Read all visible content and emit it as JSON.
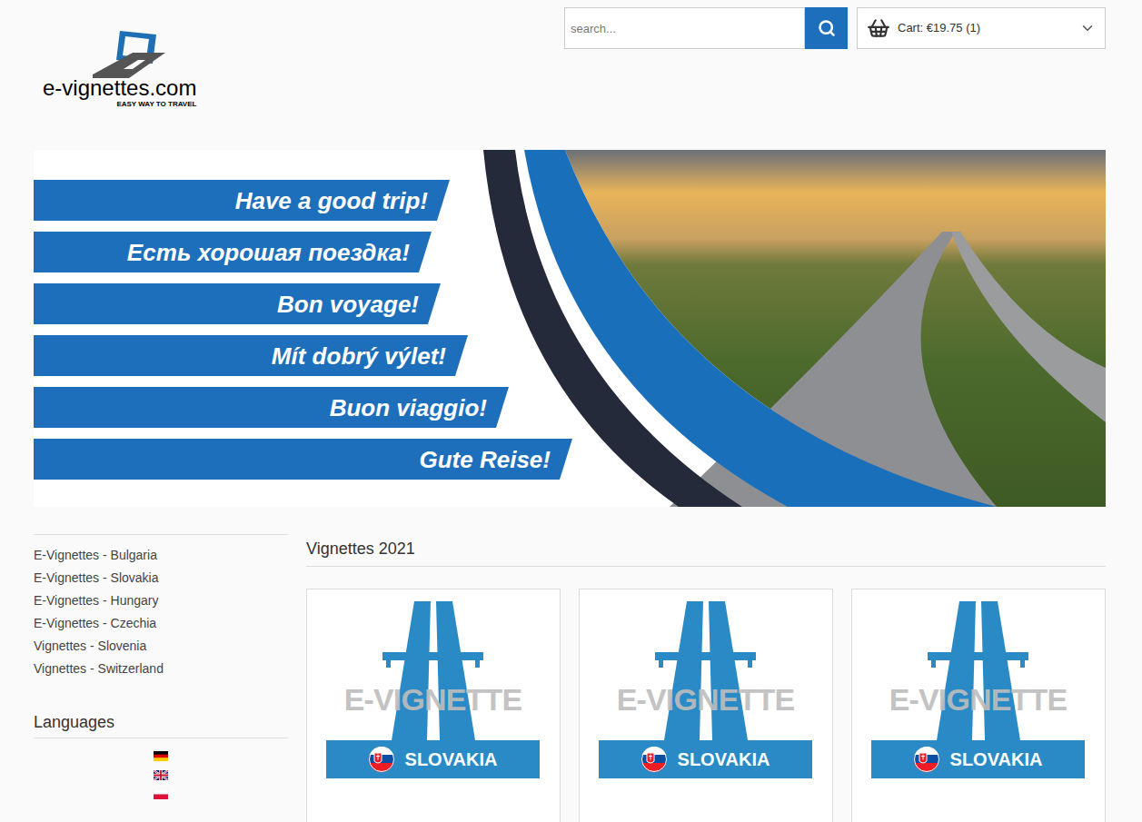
{
  "logo": {
    "name": "e-vignettes.com",
    "tagline": "EASY WAY TO TRAVEL"
  },
  "search": {
    "placeholder": "search..."
  },
  "cart": {
    "label": "Cart: €19.75 (1)"
  },
  "banner": {
    "lines": [
      "Have a good trip!",
      "Есть хорошая поездка!",
      "Bon voyage!",
      "Mít dobrý výlet!",
      "Buon viaggio!",
      "Gute Reise!"
    ]
  },
  "sidebar": {
    "categories": [
      "E-Vignettes - Bulgaria",
      "E-Vignettes - Slovakia",
      "E-Vignettes - Hungary",
      "E-Vignettes - Czechia",
      "Vignettes - Slovenia",
      "Vignettes - Switzerland"
    ],
    "languages_title": "Languages"
  },
  "section": {
    "title": "Vignettes 2021"
  },
  "products": [
    {
      "watermark": "E-VIGNETTE",
      "country": "SLOVAKIA"
    },
    {
      "watermark": "E-VIGNETTE",
      "country": "SLOVAKIA"
    },
    {
      "watermark": "E-VIGNETTE",
      "country": "SLOVAKIA"
    }
  ]
}
